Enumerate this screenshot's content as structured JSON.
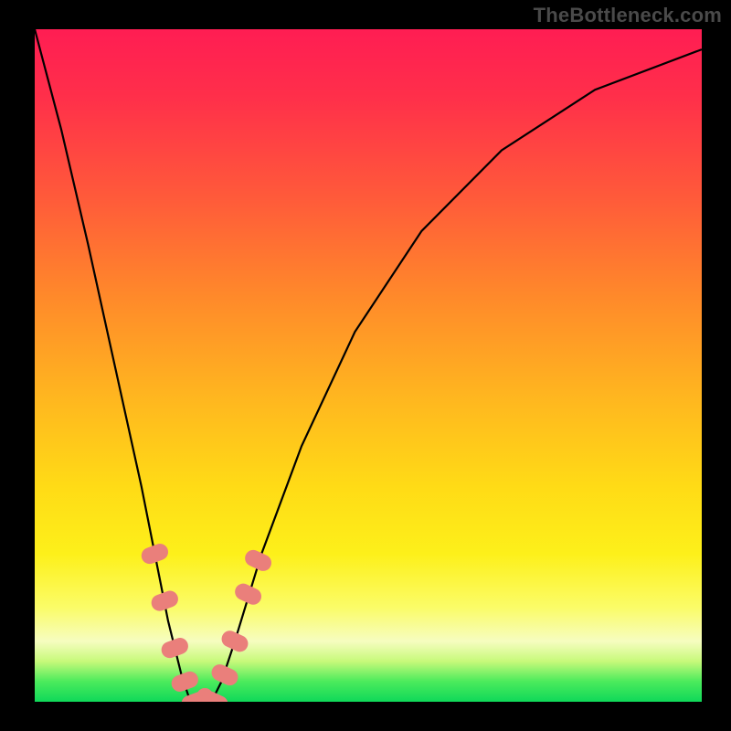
{
  "watermark": "TheBottleneck.com",
  "chart_data": {
    "type": "line",
    "title": "",
    "xlabel": "",
    "ylabel": "",
    "xlim": [
      0,
      100
    ],
    "ylim": [
      0,
      100
    ],
    "gradient_background": {
      "direction": "top-to-bottom",
      "stops": [
        {
          "pos": 0,
          "color": "#ff1d53"
        },
        {
          "pos": 25,
          "color": "#ff5a3a"
        },
        {
          "pos": 55,
          "color": "#ffb71f"
        },
        {
          "pos": 78,
          "color": "#fdf01a"
        },
        {
          "pos": 91,
          "color": "#f6fdc0"
        },
        {
          "pos": 100,
          "color": "#0fd859"
        }
      ]
    },
    "series": [
      {
        "name": "bottleneck-curve",
        "color": "#000000",
        "x": [
          0,
          4,
          8,
          12,
          16,
          18,
          20,
          22,
          23,
          24,
          25,
          26,
          27,
          28,
          30,
          34,
          40,
          48,
          58,
          70,
          84,
          100
        ],
        "values": [
          100,
          85,
          68,
          50,
          32,
          22,
          12,
          4,
          1,
          0,
          0,
          0,
          1,
          3,
          9,
          22,
          38,
          55,
          70,
          82,
          91,
          97
        ]
      }
    ],
    "markers": {
      "name": "highlight-beads",
      "color": "#ea7f7b",
      "shape": "rounded-rect",
      "points": [
        {
          "x": 18.0,
          "y": 22
        },
        {
          "x": 19.5,
          "y": 15
        },
        {
          "x": 21.0,
          "y": 8
        },
        {
          "x": 22.5,
          "y": 3
        },
        {
          "x": 24.0,
          "y": 0
        },
        {
          "x": 25.5,
          "y": 0
        },
        {
          "x": 27.0,
          "y": 0
        },
        {
          "x": 28.5,
          "y": 4
        },
        {
          "x": 30.0,
          "y": 9
        },
        {
          "x": 32.0,
          "y": 16
        },
        {
          "x": 33.5,
          "y": 21
        }
      ]
    },
    "vertex": {
      "x": 25,
      "y": 0
    }
  }
}
